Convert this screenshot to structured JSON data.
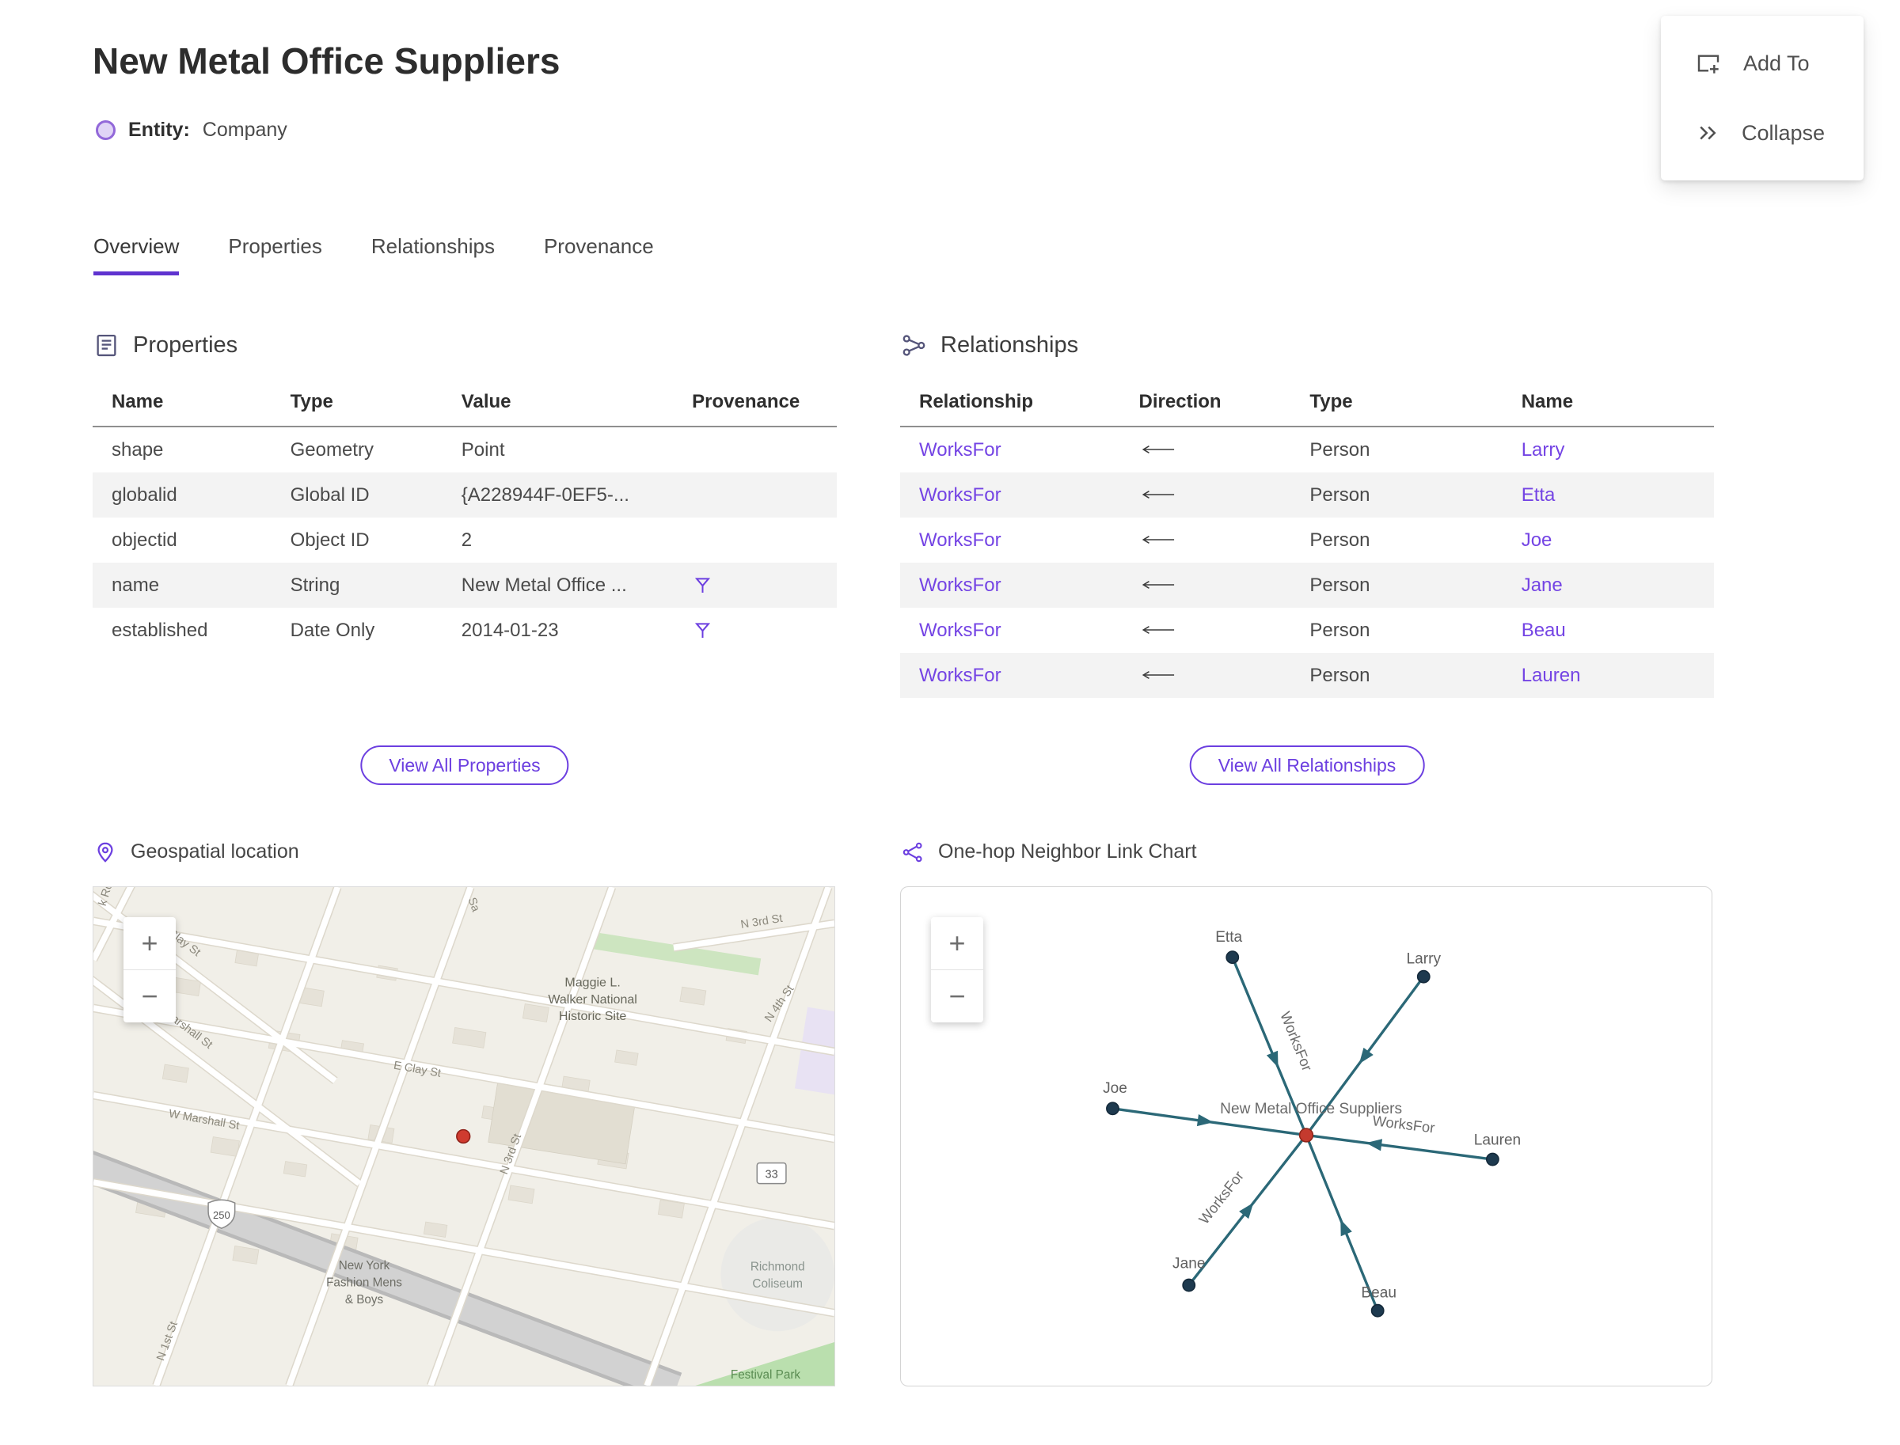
{
  "header": {
    "title": "New Metal Office Suppliers",
    "entity_label": "Entity:",
    "entity_type": "Company"
  },
  "action_panel": {
    "add_to_label": "Add To",
    "collapse_label": "Collapse"
  },
  "tabs": [
    {
      "label": "Overview",
      "active": true
    },
    {
      "label": "Properties",
      "active": false
    },
    {
      "label": "Relationships",
      "active": false
    },
    {
      "label": "Provenance",
      "active": false
    }
  ],
  "accent_color": "#6c3fe0",
  "properties": {
    "section_title": "Properties",
    "columns": [
      "Name",
      "Type",
      "Value",
      "Provenance"
    ],
    "rows": [
      {
        "name": "shape",
        "type": "Geometry",
        "value": "Point",
        "provenance": false
      },
      {
        "name": "globalid",
        "type": "Global ID",
        "value": "{A228944F-0EF5-...",
        "provenance": false
      },
      {
        "name": "objectid",
        "type": "Object ID",
        "value": "2",
        "provenance": false
      },
      {
        "name": "name",
        "type": "String",
        "value": "New Metal Office ...",
        "provenance": true
      },
      {
        "name": "established",
        "type": "Date Only",
        "value": "2014-01-23",
        "provenance": true
      }
    ],
    "view_all_label": "View All Properties"
  },
  "relationships": {
    "section_title": "Relationships",
    "columns": [
      "Relationship",
      "Direction",
      "Type",
      "Name"
    ],
    "rows": [
      {
        "relationship": "WorksFor",
        "direction": "←",
        "type": "Person",
        "name": "Larry"
      },
      {
        "relationship": "WorksFor",
        "direction": "←",
        "type": "Person",
        "name": "Etta"
      },
      {
        "relationship": "WorksFor",
        "direction": "←",
        "type": "Person",
        "name": "Joe"
      },
      {
        "relationship": "WorksFor",
        "direction": "←",
        "type": "Person",
        "name": "Jane"
      },
      {
        "relationship": "WorksFor",
        "direction": "←",
        "type": "Person",
        "name": "Beau"
      },
      {
        "relationship": "WorksFor",
        "direction": "←",
        "type": "Person",
        "name": "Lauren"
      }
    ],
    "view_all_label": "View All Relationships"
  },
  "geospatial": {
    "section_title": "Geospatial location",
    "zoom_in": "+",
    "zoom_out": "−",
    "map_labels": {
      "brook_rd": "k Ro",
      "w_clay_st": "W Clay St",
      "sa": "Sa",
      "n_3rd_st_top": "N 3rd St",
      "maggie_1": "Maggie L.",
      "maggie_2": "Walker National",
      "maggie_3": "Historic Site",
      "n_4th_st": "N 4th St",
      "marshall_st": "arshall St",
      "e_clay_st": "E Clay St",
      "w_marshall_st": "W Marshall St",
      "n_3rd_st_mid": "N 3rd St",
      "shield_250": "250",
      "shield_33": "33",
      "ny_1": "New York",
      "ny_2": "Fashion Mens",
      "ny_3": "& Boys",
      "coliseum_1": "Richmond",
      "coliseum_2": "Coliseum",
      "n_1st_st": "N 1st St",
      "festival_park": "Festival Park"
    }
  },
  "link_chart": {
    "section_title": "One-hop Neighbor Link Chart",
    "zoom_in": "+",
    "zoom_out": "−",
    "center_label": "New Metal Office Suppliers",
    "edge_label": "WorksFor",
    "nodes": {
      "etta": "Etta",
      "larry": "Larry",
      "joe": "Joe",
      "jane": "Jane",
      "beau": "Beau",
      "lauren": "Lauren"
    }
  }
}
